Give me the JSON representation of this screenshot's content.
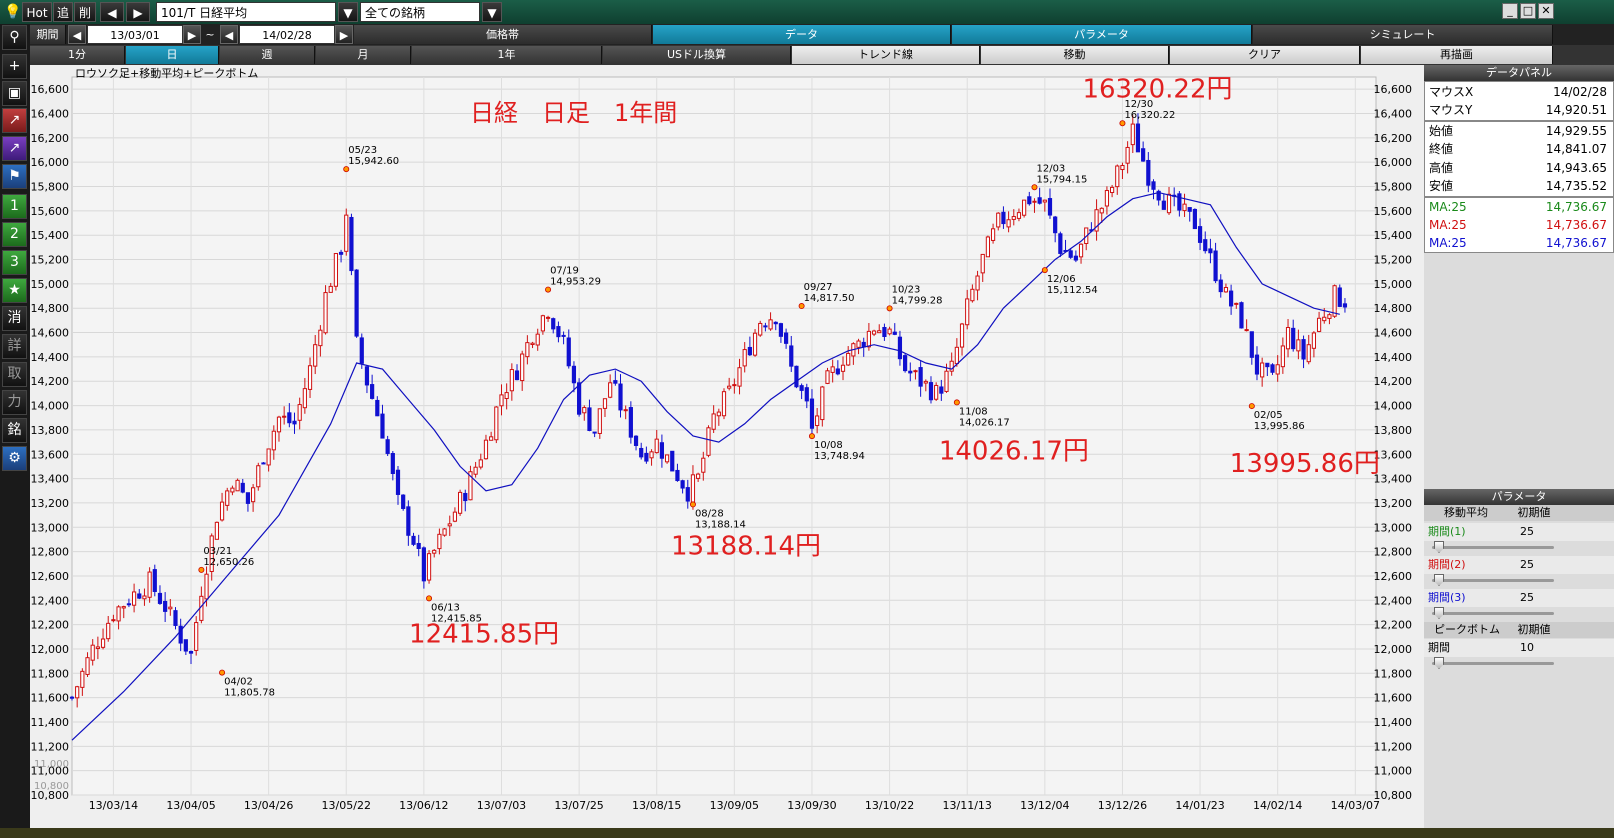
{
  "toolbar": {
    "hot": "Hot",
    "hide": "追",
    "delete": "削",
    "symbol": "101/T 日経平均",
    "universe": "全ての銘柄"
  },
  "row2": {
    "period_label": "期間",
    "date_from": "13/03/01",
    "tilde": "~",
    "date_to": "14/02/28",
    "tabs": [
      "価格帯",
      "データ",
      "パラメータ",
      "シミュレート"
    ]
  },
  "row3": {
    "tabs": [
      "1分",
      "日",
      "週",
      "月",
      "1年",
      "USドル換算",
      "トレンド線",
      "移動",
      "クリア",
      "再描画"
    ]
  },
  "icons": {
    "left": [
      "search-icon",
      "plus-icon",
      "camera-icon",
      "chart-red-icon",
      "chart-purple-icon",
      "flag-icon",
      "one-icon",
      "two-icon",
      "three-icon",
      "star-icon",
      "erase-icon",
      "detail-icon",
      "take-icon",
      "force-icon",
      "brand-icon",
      "gear-icon"
    ]
  },
  "left_buttons": [
    "1",
    "2",
    "3",
    "★",
    "消",
    "詳",
    "取",
    "力",
    "銘"
  ],
  "data_panel": {
    "title": "データパネル",
    "mouse_x_label": "マウスX",
    "mouse_x": "14/02/28",
    "mouse_y_label": "マウスY",
    "mouse_y": "14,920.51",
    "open_label": "始値",
    "open": "14,929.55",
    "close_label": "終値",
    "close": "14,841.07",
    "high_label": "高値",
    "high": "14,943.65",
    "low_label": "安値",
    "low": "14,735.52",
    "ma": [
      {
        "label": "MA:25",
        "value": "14,736.67",
        "color": "#1a8a1a"
      },
      {
        "label": "MA:25",
        "value": "14,736.67",
        "color": "#d01010"
      },
      {
        "label": "MA:25",
        "value": "14,736.67",
        "color": "#1010d0"
      }
    ]
  },
  "param_panel": {
    "title": "パラメータ",
    "ma_header": "移動平均",
    "reset": "初期値",
    "periods": [
      {
        "label": "期間(1)",
        "value": "25",
        "color": "#1a8a1a"
      },
      {
        "label": "期間(2)",
        "value": "25",
        "color": "#d01010"
      },
      {
        "label": "期間(3)",
        "value": "25",
        "color": "#1010d0"
      }
    ],
    "peak_header": "ピークボトム",
    "peak_period_label": "期間",
    "peak_period_value": "10"
  },
  "chart_data": {
    "type": "candlestick",
    "indicator_title": "ロウソク足+移動平均+ピークボトム",
    "title": "日経　日足　1年間",
    "ylim": [
      10800,
      16700
    ],
    "y_ticks": [
      16600,
      16400,
      16200,
      16000,
      15800,
      15600,
      15400,
      15200,
      15000,
      14800,
      14600,
      14400,
      14200,
      14000,
      13800,
      13600,
      13400,
      13200,
      13000,
      12800,
      12600,
      12400,
      12200,
      12000,
      11800,
      11600,
      11400,
      11200,
      11000,
      10800
    ],
    "x_ticks": [
      "13/03/14",
      "13/04/05",
      "13/04/26",
      "13/05/22",
      "13/06/12",
      "13/07/03",
      "13/07/25",
      "13/08/15",
      "13/09/05",
      "13/09/30",
      "13/10/22",
      "13/11/13",
      "13/12/04",
      "13/12/26",
      "14/01/23",
      "14/02/14",
      "14/03/07"
    ],
    "x_tick_index": [
      8,
      23,
      38,
      53,
      68,
      83,
      98,
      113,
      128,
      143,
      158,
      173,
      188,
      203,
      218,
      233,
      248
    ],
    "total_slots": 252,
    "series_summary": "daily closes approx (index: value)",
    "closes": [
      [
        0,
        11600
      ],
      [
        4,
        12000
      ],
      [
        8,
        12300
      ],
      [
        12,
        12450
      ],
      [
        15,
        12550
      ],
      [
        18,
        12350
      ],
      [
        21,
        12100
      ],
      [
        23,
        11950
      ],
      [
        25,
        12500
      ],
      [
        28,
        13100
      ],
      [
        31,
        13400
      ],
      [
        34,
        13200
      ],
      [
        37,
        13600
      ],
      [
        40,
        13900
      ],
      [
        43,
        13850
      ],
      [
        46,
        14300
      ],
      [
        49,
        14900
      ],
      [
        52,
        15300
      ],
      [
        53,
        15600
      ],
      [
        55,
        14500
      ],
      [
        57,
        14200
      ],
      [
        60,
        13800
      ],
      [
        63,
        13200
      ],
      [
        66,
        12900
      ],
      [
        68,
        12600
      ],
      [
        70,
        12800
      ],
      [
        73,
        13050
      ],
      [
        76,
        13300
      ],
      [
        80,
        13700
      ],
      [
        83,
        14100
      ],
      [
        86,
        14300
      ],
      [
        89,
        14600
      ],
      [
        92,
        14800
      ],
      [
        95,
        14500
      ],
      [
        98,
        14000
      ],
      [
        101,
        13800
      ],
      [
        104,
        14200
      ],
      [
        107,
        13900
      ],
      [
        110,
        13600
      ],
      [
        113,
        13700
      ],
      [
        116,
        13500
      ],
      [
        119,
        13300
      ],
      [
        121,
        13400
      ],
      [
        124,
        13900
      ],
      [
        127,
        14100
      ],
      [
        130,
        14400
      ],
      [
        133,
        14700
      ],
      [
        136,
        14750
      ],
      [
        139,
        14300
      ],
      [
        142,
        14000
      ],
      [
        143,
        13800
      ],
      [
        146,
        14200
      ],
      [
        149,
        14400
      ],
      [
        152,
        14500
      ],
      [
        155,
        14650
      ],
      [
        158,
        14600
      ],
      [
        161,
        14300
      ],
      [
        164,
        14200
      ],
      [
        167,
        14100
      ],
      [
        170,
        14300
      ],
      [
        173,
        14800
      ],
      [
        176,
        15200
      ],
      [
        179,
        15500
      ],
      [
        182,
        15600
      ],
      [
        185,
        15700
      ],
      [
        188,
        15650
      ],
      [
        191,
        15300
      ],
      [
        194,
        15200
      ],
      [
        197,
        15500
      ],
      [
        200,
        15700
      ],
      [
        203,
        16000
      ],
      [
        205,
        16250
      ],
      [
        208,
        15900
      ],
      [
        211,
        15700
      ],
      [
        214,
        15600
      ],
      [
        217,
        15500
      ],
      [
        220,
        15200
      ],
      [
        223,
        14900
      ],
      [
        226,
        14700
      ],
      [
        229,
        14300
      ],
      [
        232,
        14200
      ],
      [
        235,
        14600
      ],
      [
        238,
        14400
      ],
      [
        241,
        14700
      ],
      [
        244,
        14900
      ],
      [
        247,
        14850
      ]
    ],
    "ma25": [
      [
        0,
        11250
      ],
      [
        10,
        11650
      ],
      [
        20,
        12100
      ],
      [
        30,
        12600
      ],
      [
        40,
        13100
      ],
      [
        50,
        13850
      ],
      [
        55,
        14350
      ],
      [
        60,
        14300
      ],
      [
        65,
        14050
      ],
      [
        70,
        13800
      ],
      [
        75,
        13500
      ],
      [
        80,
        13300
      ],
      [
        85,
        13350
      ],
      [
        90,
        13650
      ],
      [
        95,
        14050
      ],
      [
        100,
        14250
      ],
      [
        105,
        14300
      ],
      [
        110,
        14200
      ],
      [
        115,
        13950
      ],
      [
        120,
        13750
      ],
      [
        125,
        13700
      ],
      [
        130,
        13850
      ],
      [
        135,
        14050
      ],
      [
        140,
        14200
      ],
      [
        145,
        14350
      ],
      [
        150,
        14450
      ],
      [
        155,
        14500
      ],
      [
        160,
        14450
      ],
      [
        165,
        14350
      ],
      [
        170,
        14300
      ],
      [
        175,
        14500
      ],
      [
        180,
        14800
      ],
      [
        185,
        15000
      ],
      [
        190,
        15200
      ],
      [
        195,
        15350
      ],
      [
        200,
        15550
      ],
      [
        205,
        15700
      ],
      [
        210,
        15750
      ],
      [
        215,
        15700
      ],
      [
        220,
        15650
      ],
      [
        225,
        15300
      ],
      [
        230,
        15000
      ],
      [
        235,
        14900
      ],
      [
        240,
        14800
      ],
      [
        245,
        14750
      ]
    ],
    "peaks": [
      {
        "i": 25,
        "value": "12,650.26",
        "date": "03/21",
        "kind": "high",
        "y": 12650
      },
      {
        "i": 29,
        "value": "11,805.78",
        "date": "04/02",
        "kind": "low",
        "y": 11806
      },
      {
        "i": 53,
        "value": "15,942.60",
        "date": "05/23",
        "kind": "high",
        "y": 15943
      },
      {
        "i": 69,
        "value": "12,415.85",
        "date": "06/13",
        "kind": "low",
        "y": 12416
      },
      {
        "i": 92,
        "value": "14,953.29",
        "date": "07/19",
        "kind": "high",
        "y": 14953
      },
      {
        "i": 120,
        "value": "13,188.14",
        "date": "08/28",
        "kind": "low",
        "y": 13188
      },
      {
        "i": 141,
        "value": "14,817.50",
        "date": "09/27",
        "kind": "high",
        "y": 14818
      },
      {
        "i": 143,
        "value": "13,748.94",
        "date": "10/08",
        "kind": "low",
        "y": 13749
      },
      {
        "i": 158,
        "value": "14,799.28",
        "date": "10/23",
        "kind": "high",
        "y": 14799
      },
      {
        "i": 171,
        "value": "14,026.17",
        "date": "11/08",
        "kind": "low",
        "y": 14026
      },
      {
        "i": 186,
        "value": "15,794.15",
        "date": "12/03",
        "kind": "high",
        "y": 15794
      },
      {
        "i": 188,
        "value": "15,112.54",
        "date": "12/06",
        "kind": "low",
        "y": 15113
      },
      {
        "i": 203,
        "value": "16,320.22",
        "date": "12/30",
        "kind": "high",
        "y": 16320
      },
      {
        "i": 228,
        "value": "13,995.86",
        "date": "02/05",
        "kind": "low",
        "y": 13996
      }
    ],
    "annotations": [
      {
        "text": "16320.22円",
        "i": 203,
        "y": 16300
      },
      {
        "text": "12415.85円",
        "i": 69,
        "y": 12415
      },
      {
        "text": "13188.14円",
        "i": 120,
        "y": 13188
      },
      {
        "text": "14026.17円",
        "i": 171,
        "y": 14026
      },
      {
        "text": "13995.86円",
        "i": 228,
        "y": 13996
      }
    ],
    "colors": {
      "up": "#d01010",
      "down": "#1010d0",
      "ma": "#1010c0",
      "peak": "#ff9900"
    }
  },
  "bottom_strip_labels": [
    "10,800",
    "11,000"
  ]
}
